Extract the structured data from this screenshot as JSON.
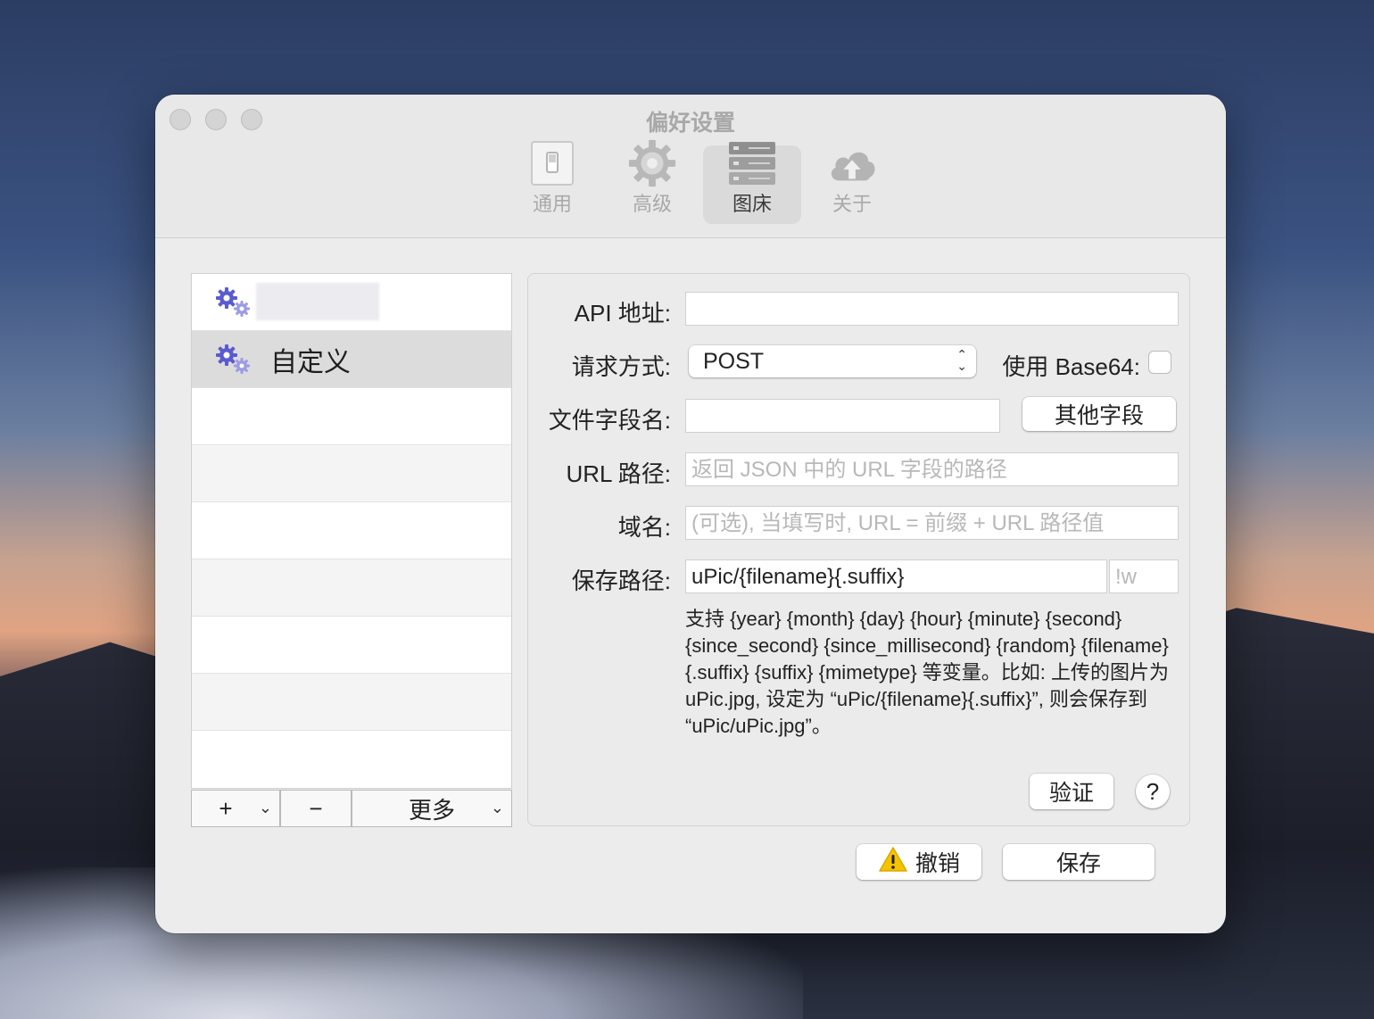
{
  "window": {
    "title": "偏好设置"
  },
  "toolbar": {
    "items": [
      {
        "label": "通用",
        "icon": "switch-icon"
      },
      {
        "label": "高级",
        "icon": "gear-icon"
      },
      {
        "label": "图床",
        "icon": "server-icon"
      },
      {
        "label": "关于",
        "icon": "cloud-upload-icon"
      }
    ],
    "active_index": 2
  },
  "hosts": {
    "items": [
      {
        "label": "",
        "icon": "gears-icon"
      },
      {
        "label": "自定义",
        "icon": "gears-icon",
        "selected": true
      }
    ],
    "add_label": "+",
    "remove_label": "−",
    "more_label": "更多"
  },
  "form": {
    "api_label": "API 地址:",
    "api_value": "",
    "method_label": "请求方式:",
    "method_value": "POST",
    "base64_label": "使用 Base64:",
    "base64_checked": false,
    "file_field_label": "文件字段名:",
    "file_field_value": "",
    "other_fields_button": "其他字段",
    "url_path_label": "URL 路径:",
    "url_path_placeholder": "返回 JSON 中的 URL 字段的路径",
    "domain_label": "域名:",
    "domain_placeholder": "(可选), 当填写时, URL = 前缀 + URL 路径值",
    "save_path_label": "保存路径:",
    "save_path_value": "uPic/{filename}{.suffix}",
    "suffix_placeholder": "!w",
    "description": "支持 {year} {month} {day} {hour} {minute} {second} {since_second} {since_millisecond} {random} {filename} {.suffix} {suffix} {mimetype} 等变量。比如: 上传的图片为 uPic.jpg, 设定为 “uPic/{filename}{.suffix}”, 则会保存到 “uPic/uPic.jpg”。",
    "verify_button": "验证",
    "help_button": "?"
  },
  "footer": {
    "revert_button": "撤销",
    "save_button": "保存"
  }
}
